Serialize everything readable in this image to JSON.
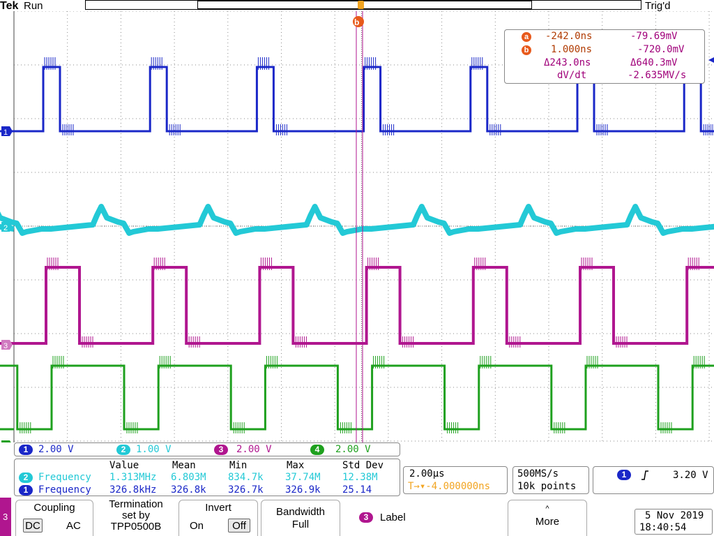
{
  "header": {
    "logo": "Tek",
    "acq_state": "Run",
    "trig_state": "Trig'd"
  },
  "cursors": {
    "a_label": "a",
    "b_label": "b",
    "marker_label": "b",
    "a_time": "-242.0ns",
    "a_volt": "-79.69mV",
    "b_time": "1.000ns",
    "b_volt": "-720.0mV",
    "delta_time": "Δ243.0ns",
    "delta_volt": "Δ640.3mV",
    "dvdt_label": "dV/dt",
    "dvdt_value": "-2.635MV/s"
  },
  "channels": [
    {
      "num": "1",
      "scale": "2.00 V",
      "color": "#1a27c8"
    },
    {
      "num": "2",
      "scale": "1.00 V",
      "color": "#23c9d6"
    },
    {
      "num": "3",
      "scale": "2.00 V",
      "color": "#b0168f"
    },
    {
      "num": "4",
      "scale": "2.00 V",
      "color": "#1ea01e"
    }
  ],
  "measurements": {
    "headers": [
      "Value",
      "Mean",
      "Min",
      "Max",
      "Std Dev"
    ],
    "rows": [
      {
        "ch": "2",
        "name": "Frequency",
        "value": "1.313MHz",
        "mean": "6.803M",
        "min": "834.7k",
        "max": "37.74M",
        "std": "12.38M",
        "color": "#23c9d6"
      },
      {
        "ch": "1",
        "name": "Frequency",
        "value": "326.8kHz",
        "mean": "326.8k",
        "min": "326.7k",
        "max": "326.9k",
        "std": "25.14",
        "color": "#1a27c8"
      }
    ]
  },
  "timebase": {
    "scale": "2.00µs",
    "delay": "T→▾-4.000000ns"
  },
  "sampling": {
    "rate": "500MS/s",
    "points": "10k points"
  },
  "trigger": {
    "source": "1",
    "level": "3.20 V"
  },
  "menu": {
    "channel_tab": "3",
    "coupling": {
      "title": "Coupling",
      "dc": "DC",
      "ac": "AC"
    },
    "termination": {
      "line1": "Termination",
      "line2": "set by",
      "line3": "TPP0500B"
    },
    "invert": {
      "title": "Invert",
      "on": "On",
      "off": "Off"
    },
    "bandwidth": {
      "title": "Bandwidth",
      "value": "Full"
    },
    "label": {
      "ch": "3",
      "title": "Label"
    },
    "more": {
      "title": "More"
    }
  },
  "datetime": {
    "date": "5 Nov 2019",
    "time": "18:40:54"
  }
}
